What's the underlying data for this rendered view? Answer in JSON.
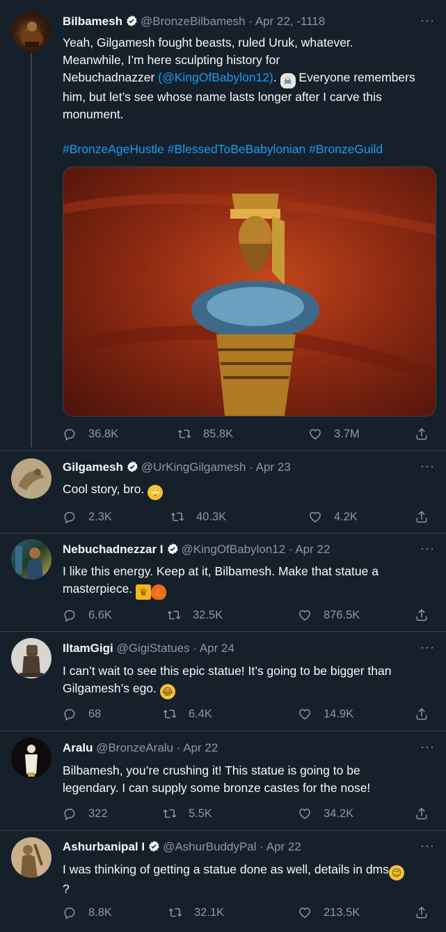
{
  "tweets": [
    {
      "name": "Bilbamesh",
      "handle": "@BronzeBilbamesh",
      "date": "Apr 22, -1118",
      "text_a": "Yeah, Gilgamesh fought beasts, ruled Uruk, whatever.",
      "text_b": "Meanwhile, I’m here sculpting history for",
      "text_c1": "Nebuchadnazzer ",
      "mention": "(@KingOfBabylon12)",
      "text_c2": ". ",
      "text_c3": " Everyone remembers",
      "text_d": "him, but let’s see whose name lasts longer after I carve this",
      "text_e": "monument.",
      "hashtags": "#BronzeAgeHustle #BlessedToBeBabylonian #BronzeGuild",
      "replies": "36.8K",
      "retweets": "85.8K",
      "likes": "3.7M"
    },
    {
      "name": "Gilgamesh",
      "handle": "@UrKingGilgamesh",
      "date": "Apr 23",
      "text": "Cool story, bro. ",
      "replies": "2.3K",
      "retweets": "40.3K",
      "likes": "4.2K"
    },
    {
      "name": "Nebuchadnezzar I",
      "handle": "@KingOfBabylon12",
      "date": "Apr 22",
      "text_a": "I like this energy. Keep at it, Bilbamesh. Make that statue a",
      "text_b": "masterpiece. ",
      "replies": "6.6K",
      "retweets": "32.5K",
      "likes": "876.5K"
    },
    {
      "name": "IltamGigi",
      "handle": "@GigiStatues",
      "date": "Apr 24",
      "text_a": "I can’t wait to see this epic statue! It’s going to be bigger than",
      "text_b": "Gilgamesh’s ego. ",
      "replies": "68",
      "retweets": "6.4K",
      "likes": "14.9K"
    },
    {
      "name": "Aralu",
      "handle": "@BronzeAralu",
      "date": "Apr 22",
      "text_a": "Bilbamesh, you’re crushing it! This statue is going to be",
      "text_b": "legendary. I can supply some bronze castes for the nose!",
      "replies": "322",
      "retweets": "5.5K",
      "likes": "34.2K"
    },
    {
      "name": "Ashurbanipal I",
      "handle": "@AshurBuddyPal",
      "date": "Apr 22",
      "text_a": "I was thinking of getting a statue done as well, details in dms",
      "text_b": "?",
      "replies": "8.8K",
      "retweets": "32.1K",
      "likes": "213.5K"
    }
  ],
  "sep": "·",
  "more": "···"
}
